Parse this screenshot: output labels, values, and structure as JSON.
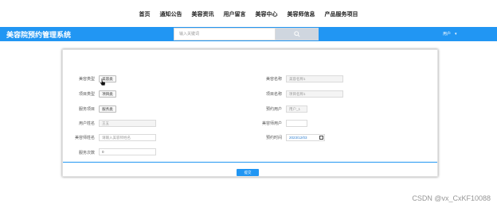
{
  "topnav": {
    "items": [
      "首页",
      "通知公告",
      "美容资讯",
      "用户留言",
      "美容中心",
      "美容师信息",
      "产品服务项目"
    ]
  },
  "header": {
    "brand": "美容院预约管理系统",
    "search_placeholder": "输入关键词",
    "user_label": "用户",
    "user_caret": "▾",
    "bar_color": "#2196f3"
  },
  "form": {
    "labels": {
      "beauty_type": "美容类型",
      "project_type": "项目类型",
      "service_project": "服务项目",
      "user_name": "用户姓名",
      "beautician_name": "美容师姓名",
      "service_count": "服务次数",
      "beauty_name": "美容名称",
      "project_name": "项目名称",
      "member_user": "预约用户",
      "beauty_user": "美容师用户",
      "reserve_time": "预约时间"
    },
    "values": {
      "beauty_type_btn": "美容类",
      "project_type_btn": "项目类",
      "service_project_btn": "服务类",
      "user_name": "王五",
      "beautician_placeholder": "请输入美容师姓名",
      "service_count": "0",
      "beauty_name": "美容名称1",
      "project_name": "项目名称1",
      "member_user": "用户_1",
      "beauty_user": "",
      "reserve_time": "2023/12/03"
    },
    "submit_label": "提交"
  },
  "watermark": "CSDN @vx_CxKF10088"
}
